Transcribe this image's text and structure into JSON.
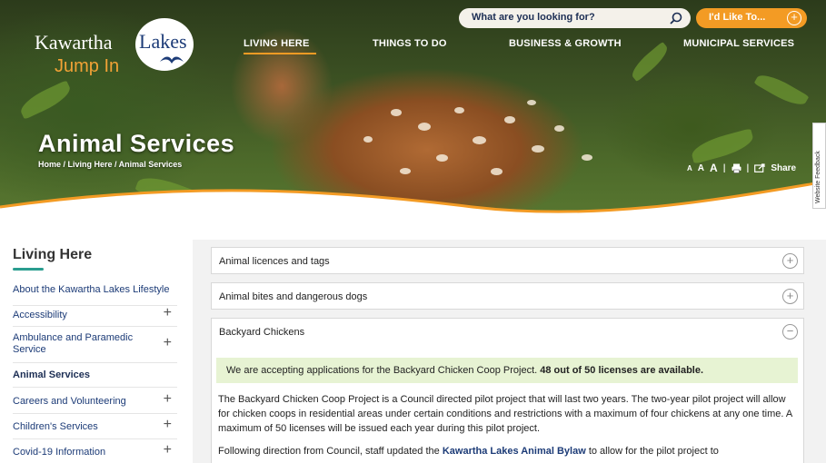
{
  "header": {
    "logo": {
      "line1": "Kawartha",
      "line2": "Lakes",
      "tagline": "Jump In"
    },
    "search": {
      "placeholder": "What are you looking for?"
    },
    "i_like_to": {
      "label": "I'd Like To..."
    },
    "nav": [
      {
        "label": "LIVING HERE",
        "active": true
      },
      {
        "label": "THINGS TO DO"
      },
      {
        "label": "BUSINESS & GROWTH"
      },
      {
        "label": "MUNICIPAL SERVICES"
      }
    ]
  },
  "hero": {
    "title": "Animal Services",
    "breadcrumb": "Home / Living Here / Animal Services",
    "tools": {
      "font_small": "A",
      "font_medium": "A",
      "font_large": "A",
      "share_label": "Share"
    },
    "feedback_label": "Website Feedback"
  },
  "sidebar": {
    "title": "Living Here",
    "accent_color": "#2a9d8f",
    "items": [
      {
        "label": "About the Kawartha Lakes Lifestyle",
        "expandable": false
      },
      {
        "label": "Accessibility",
        "expandable": true
      },
      {
        "label": "Ambulance and Paramedic Service",
        "expandable": true
      },
      {
        "label": "Animal Services",
        "expandable": false,
        "active": true
      },
      {
        "label": "Careers and Volunteering",
        "expandable": true
      },
      {
        "label": "Children's Services",
        "expandable": true
      },
      {
        "label": "Covid-19 Information",
        "expandable": true
      }
    ],
    "expand_glyph": "+"
  },
  "main": {
    "accordions": [
      {
        "label": "Animal licences and tags",
        "icon": "+",
        "expanded": false
      },
      {
        "label": "Animal bites and dangerous dogs",
        "icon": "+",
        "expanded": false
      },
      {
        "label": "Backyard Chickens",
        "icon": "−",
        "expanded": true
      }
    ],
    "notice": {
      "text": "We are accepting applications for the Backyard Chicken Coop Project. ",
      "bold": "48 out of 50 licenses are available."
    },
    "paragraph1": "The Backyard Chicken Coop Project is a Council directed pilot project that will last two years. The two-year pilot project will allow for chicken coops in residential areas under certain conditions and restrictions with a maximum of four chickens at any one time. A maximum of 50 licenses will be issued each year during this pilot project.",
    "paragraph2_before": "Following direction from Council, staff updated the ",
    "paragraph2_link": "Kawartha Lakes Animal Bylaw",
    "paragraph2_after": " to allow for the pilot project to"
  },
  "colors": {
    "brand_navy": "#1c3b77",
    "accent_orange": "#f39b24",
    "notice_green": "#e7f3d3"
  }
}
